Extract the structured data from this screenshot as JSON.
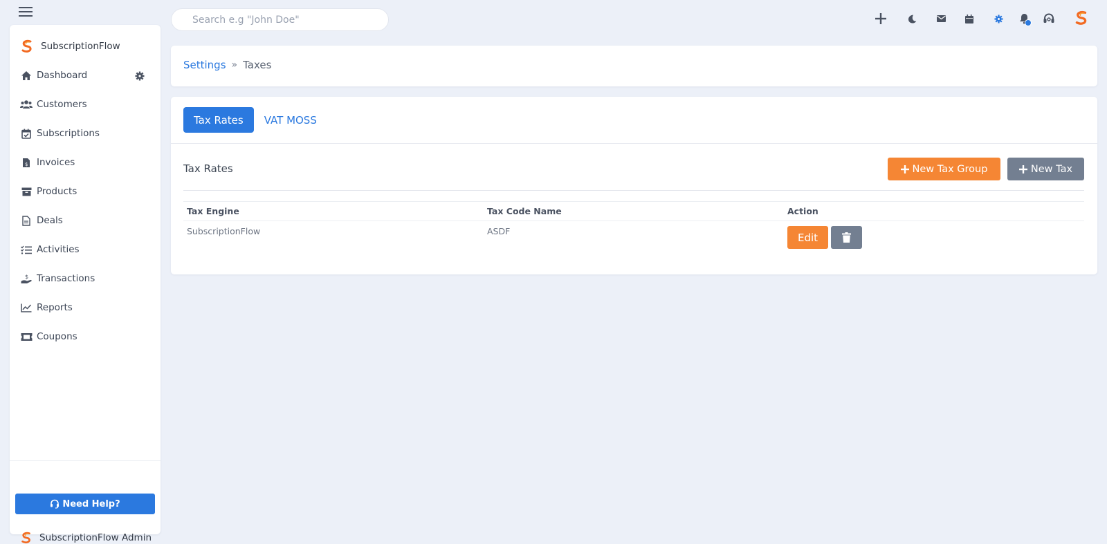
{
  "app": {
    "name": "SubscriptionFlow",
    "admin_name": "SubscriptionFlow Admin"
  },
  "colors": {
    "accent": "#2b79df",
    "orange": "#f58634",
    "gray_button": "#737f91",
    "background": "#ecf0f8"
  },
  "icons": {
    "hamburger": "hamburger-menu-icon",
    "top": [
      "plus-icon",
      "moon-icon",
      "envelope-icon",
      "calendar-icon",
      "gear-icon",
      "bell-icon",
      "headset-icon",
      "brand-logo-icon"
    ]
  },
  "search": {
    "placeholder": "Search e.g \"John Doe\"",
    "value": ""
  },
  "sidebar": {
    "items": [
      {
        "label": "Dashboard",
        "icon": "home-icon"
      },
      {
        "label": "Customers",
        "icon": "users-icon"
      },
      {
        "label": "Subscriptions",
        "icon": "calendar-check-icon"
      },
      {
        "label": "Invoices",
        "icon": "invoice-icon"
      },
      {
        "label": "Products",
        "icon": "archive-box-icon"
      },
      {
        "label": "Deals",
        "icon": "document-icon"
      },
      {
        "label": "Activities",
        "icon": "tasks-list-icon"
      },
      {
        "label": "Transactions",
        "icon": "hand-dollar-icon"
      },
      {
        "label": "Reports",
        "icon": "line-chart-icon"
      },
      {
        "label": "Coupons",
        "icon": "ticket-icon"
      }
    ],
    "need_help": "Need Help?"
  },
  "breadcrumb": {
    "parent": "Settings",
    "separator": "»",
    "current": "Taxes"
  },
  "tabs": [
    {
      "label": "Tax Rates",
      "active": true
    },
    {
      "label": "VAT MOSS",
      "active": false
    }
  ],
  "section": {
    "title": "Tax Rates",
    "new_group_label": "New Tax Group",
    "new_tax_label": "New Tax"
  },
  "table": {
    "headers": [
      "Tax Engine",
      "Tax Code Name",
      "Action"
    ],
    "rows": [
      {
        "engine": "SubscriptionFlow",
        "code_name": "ASDF",
        "edit_label": "Edit"
      }
    ]
  }
}
